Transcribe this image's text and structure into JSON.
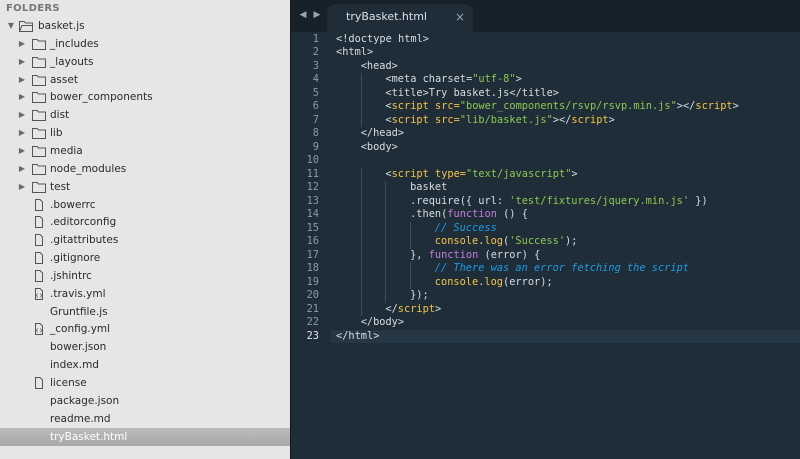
{
  "sidebar": {
    "header": "FOLDERS",
    "items": [
      {
        "label": "basket.js",
        "kind": "folder-open",
        "depth": 0,
        "expandable": true,
        "expanded": true
      },
      {
        "label": "_includes",
        "kind": "folder",
        "depth": 1,
        "expandable": true
      },
      {
        "label": "_layouts",
        "kind": "folder",
        "depth": 1,
        "expandable": true
      },
      {
        "label": "asset",
        "kind": "folder",
        "depth": 1,
        "expandable": true
      },
      {
        "label": "bower_components",
        "kind": "folder",
        "depth": 1,
        "expandable": true
      },
      {
        "label": "dist",
        "kind": "folder",
        "depth": 1,
        "expandable": true
      },
      {
        "label": "lib",
        "kind": "folder",
        "depth": 1,
        "expandable": true
      },
      {
        "label": "media",
        "kind": "folder",
        "depth": 1,
        "expandable": true
      },
      {
        "label": "node_modules",
        "kind": "folder",
        "depth": 1,
        "expandable": true
      },
      {
        "label": "test",
        "kind": "folder",
        "depth": 1,
        "expandable": true
      },
      {
        "label": ".bowerrc",
        "kind": "file",
        "depth": 1
      },
      {
        "label": ".editorconfig",
        "kind": "file",
        "depth": 1
      },
      {
        "label": ".gitattributes",
        "kind": "file",
        "depth": 1
      },
      {
        "label": ".gitignore",
        "kind": "file",
        "depth": 1
      },
      {
        "label": ".jshintrc",
        "kind": "file",
        "depth": 1
      },
      {
        "label": ".travis.yml",
        "kind": "file-code",
        "depth": 1
      },
      {
        "label": "Gruntfile.js",
        "kind": "none",
        "depth": 1
      },
      {
        "label": "_config.yml",
        "kind": "file-code",
        "depth": 1
      },
      {
        "label": "bower.json",
        "kind": "none",
        "depth": 1
      },
      {
        "label": "index.md",
        "kind": "none",
        "depth": 1
      },
      {
        "label": "license",
        "kind": "file",
        "depth": 1
      },
      {
        "label": "package.json",
        "kind": "none",
        "depth": 1
      },
      {
        "label": "readme.md",
        "kind": "none",
        "depth": 1
      },
      {
        "label": "tryBasket.html",
        "kind": "none",
        "depth": 1,
        "selected": true
      }
    ]
  },
  "editor": {
    "nav_back_icon": "triangle-left-icon",
    "nav_forward_icon": "triangle-right-icon",
    "tab": {
      "title": "tryBasket.html",
      "close_glyph": "×"
    },
    "current_line": 23,
    "colors": {
      "background": "#1f2d38",
      "tag": "#f4c34a",
      "string": "#8dc853",
      "comment": "#1e9be4",
      "keyword": "#c47cdb",
      "plain": "#d4dde2"
    },
    "lines": [
      {
        "n": "1",
        "indent": 0,
        "tokens": [
          [
            "p",
            "<!doctype html>"
          ]
        ]
      },
      {
        "n": "2",
        "indent": 0,
        "tokens": [
          [
            "p",
            "<html>"
          ]
        ]
      },
      {
        "n": "3",
        "indent": 1,
        "tokens": [
          [
            "p",
            "<head>"
          ]
        ]
      },
      {
        "n": "4",
        "indent": 2,
        "tokens": [
          [
            "p",
            "<meta charset="
          ],
          [
            "s",
            "\"utf-8\""
          ],
          [
            "p",
            ">"
          ]
        ]
      },
      {
        "n": "5",
        "indent": 2,
        "tokens": [
          [
            "p",
            "<title>Try basket.js</title>"
          ]
        ]
      },
      {
        "n": "6",
        "indent": 2,
        "tokens": [
          [
            "p",
            "<"
          ],
          [
            "t",
            "script"
          ],
          [
            "a",
            " src="
          ],
          [
            "s",
            "\"bower_components/rsvp/rsvp.min.js\""
          ],
          [
            "p",
            "></"
          ],
          [
            "t",
            "script"
          ],
          [
            "p",
            ">"
          ]
        ]
      },
      {
        "n": "7",
        "indent": 2,
        "tokens": [
          [
            "p",
            "<"
          ],
          [
            "t",
            "script"
          ],
          [
            "a",
            " src="
          ],
          [
            "s",
            "\"lib/basket.js\""
          ],
          [
            "p",
            "></"
          ],
          [
            "t",
            "script"
          ],
          [
            "p",
            ">"
          ]
        ]
      },
      {
        "n": "8",
        "indent": 1,
        "tokens": [
          [
            "p",
            "</head>"
          ]
        ]
      },
      {
        "n": "9",
        "indent": 1,
        "tokens": [
          [
            "p",
            "<body>"
          ]
        ]
      },
      {
        "n": "10",
        "indent": 0,
        "tokens": []
      },
      {
        "n": "11",
        "indent": 2,
        "tokens": [
          [
            "p",
            "<"
          ],
          [
            "t",
            "script"
          ],
          [
            "a",
            " type="
          ],
          [
            "s",
            "\"text/javascript\""
          ],
          [
            "p",
            ">"
          ]
        ]
      },
      {
        "n": "12",
        "indent": 3,
        "tokens": [
          [
            "p",
            "basket"
          ]
        ]
      },
      {
        "n": "13",
        "indent": 3,
        "tokens": [
          [
            "p",
            ".require({ url: "
          ],
          [
            "s",
            "'test/fixtures/jquery.min.js'"
          ],
          [
            "p",
            " })"
          ]
        ]
      },
      {
        "n": "14",
        "indent": 3,
        "tokens": [
          [
            "p",
            ".then("
          ],
          [
            "k",
            "function"
          ],
          [
            "p",
            " () {"
          ]
        ]
      },
      {
        "n": "15",
        "indent": 4,
        "tokens": [
          [
            "c",
            "// Success"
          ]
        ]
      },
      {
        "n": "16",
        "indent": 4,
        "tokens": [
          [
            "f",
            "console"
          ],
          [
            "p",
            "."
          ],
          [
            "f",
            "log"
          ],
          [
            "p",
            "("
          ],
          [
            "s",
            "'Success'"
          ],
          [
            "p",
            ");"
          ]
        ]
      },
      {
        "n": "17",
        "indent": 3,
        "tokens": [
          [
            "p",
            "}, "
          ],
          [
            "k",
            "function"
          ],
          [
            "p",
            " (error) {"
          ]
        ]
      },
      {
        "n": "18",
        "indent": 4,
        "tokens": [
          [
            "c",
            "// There was an error fetching the script"
          ]
        ]
      },
      {
        "n": "19",
        "indent": 4,
        "tokens": [
          [
            "f",
            "console"
          ],
          [
            "p",
            "."
          ],
          [
            "f",
            "log"
          ],
          [
            "p",
            "(error);"
          ]
        ]
      },
      {
        "n": "20",
        "indent": 3,
        "tokens": [
          [
            "p",
            "});"
          ]
        ]
      },
      {
        "n": "21",
        "indent": 2,
        "tokens": [
          [
            "p",
            "</"
          ],
          [
            "t",
            "script"
          ],
          [
            "p",
            ">"
          ]
        ]
      },
      {
        "n": "22",
        "indent": 1,
        "tokens": [
          [
            "p",
            "</body>"
          ]
        ]
      },
      {
        "n": "23",
        "indent": 0,
        "tokens": [
          [
            "p",
            "</html>"
          ]
        ]
      }
    ]
  }
}
